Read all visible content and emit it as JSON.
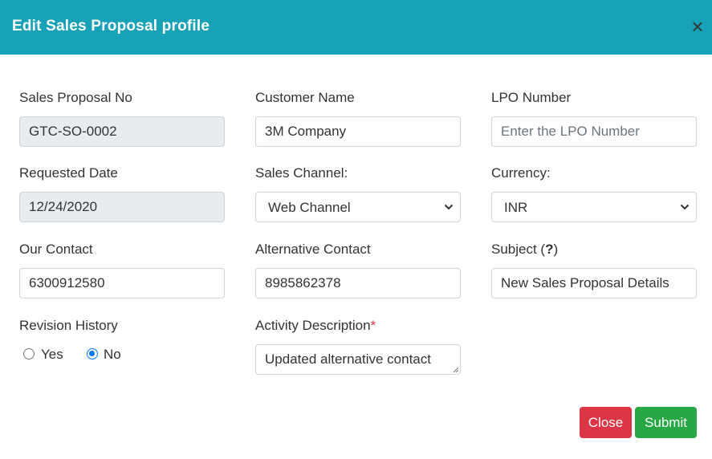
{
  "modal": {
    "title": "Edit Sales Proposal profile",
    "close_glyph": "×"
  },
  "form": {
    "sales_proposal_no": {
      "label": "Sales Proposal No",
      "value": "GTC-SO-0002"
    },
    "customer_name": {
      "label": "Customer Name",
      "value": "3M Company"
    },
    "lpo_number": {
      "label": "LPO Number",
      "value": "",
      "placeholder": "Enter the LPO Number"
    },
    "requested_date": {
      "label": "Requested Date",
      "value": "12/24/2020"
    },
    "sales_channel": {
      "label": "Sales Channel:",
      "value": "Web Channel"
    },
    "currency": {
      "label": "Currency:",
      "value": "INR"
    },
    "our_contact": {
      "label": "Our Contact",
      "value": "6300912580"
    },
    "alternative_contact": {
      "label": "Alternative Contact",
      "value": "8985862378"
    },
    "subject": {
      "label_prefix": "Subject (",
      "label_help": "?",
      "label_suffix": ")",
      "value": "New Sales Proposal Details"
    },
    "revision_history": {
      "label": "Revision History",
      "options": [
        {
          "label": "Yes",
          "checked": false
        },
        {
          "label": "No",
          "checked": true
        }
      ]
    },
    "activity_description": {
      "label": "Activity Description",
      "required_mark": "*",
      "value": "Updated alternative contact"
    }
  },
  "footer": {
    "close_label": "Close",
    "submit_label": "Submit"
  },
  "colors": {
    "header": "#17a2b8",
    "close_button": "#dc3545",
    "submit_button": "#28a745",
    "required": "#dc3545",
    "radio_accent": "#0075ff"
  }
}
